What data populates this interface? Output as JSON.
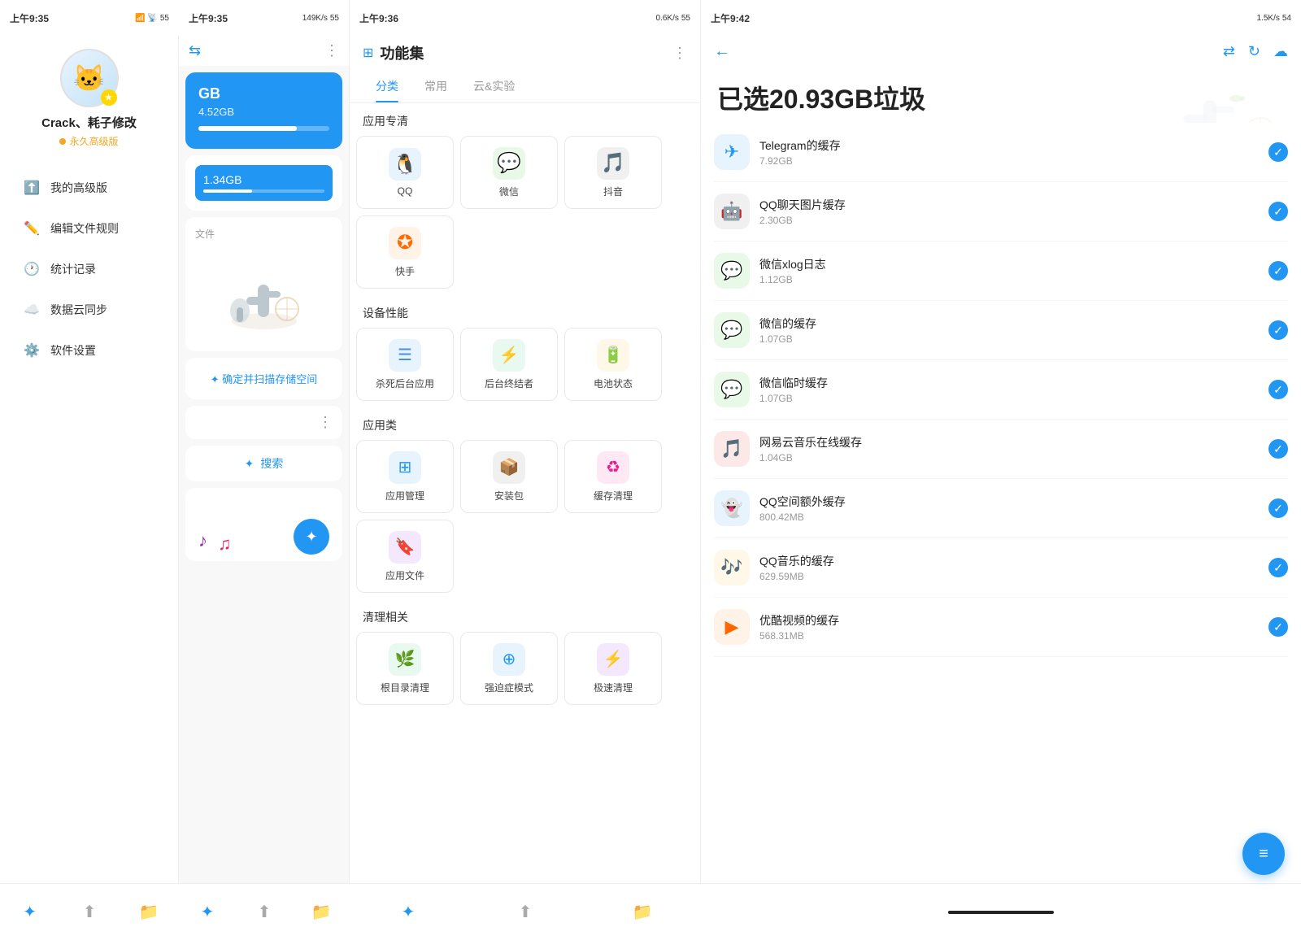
{
  "panel1": {
    "status_time": "上午9:35",
    "username": "Crack、耗子修改",
    "vip_label": "永久高级版",
    "menu_items": [
      {
        "id": "premium",
        "label": "我的高级版",
        "icon": "⬆"
      },
      {
        "id": "rules",
        "label": "编辑文件规则",
        "icon": "✏"
      },
      {
        "id": "history",
        "label": "统计记录",
        "icon": "🕐"
      },
      {
        "id": "cloud",
        "label": "数据云同步",
        "icon": "☁"
      },
      {
        "id": "settings",
        "label": "软件设置",
        "icon": "⚙"
      }
    ],
    "bottom_nav": [
      {
        "id": "clean",
        "icon": "✦",
        "active": true
      },
      {
        "id": "upload",
        "icon": "⬆"
      },
      {
        "id": "folder",
        "icon": "📁"
      }
    ]
  },
  "panel2": {
    "status_time": "上午9:35",
    "status_speed": "149K/s",
    "storage_title": "GB",
    "storage_subtitle": "4.52GB",
    "storage_bar_pct": 75,
    "second_subtitle": "1.34GB",
    "file_label": "文件",
    "confirm_text": "✦ 确定并扫描存储空间",
    "search_icon": "✦",
    "search_label": "搜索",
    "music_note1": "♪",
    "music_note2": "♫",
    "bottom_nav": [
      {
        "id": "clean",
        "icon": "✦",
        "active": true
      },
      {
        "id": "upload",
        "icon": "⬆"
      },
      {
        "id": "folder",
        "icon": "📁"
      }
    ]
  },
  "panel3": {
    "status_time": "上午9:36",
    "status_speed": "0.6K/s",
    "title": "功能集",
    "tabs": [
      {
        "id": "category",
        "label": "分类",
        "active": true
      },
      {
        "id": "common",
        "label": "常用",
        "active": false
      },
      {
        "id": "cloud",
        "label": "云&实验",
        "active": false
      }
    ],
    "sections": [
      {
        "title": "应用专清",
        "items": [
          {
            "id": "qq",
            "label": "QQ",
            "bg": "#1296DB",
            "icon": "🐧"
          },
          {
            "id": "wechat",
            "label": "微信",
            "bg": "#2DC100",
            "icon": "💬"
          },
          {
            "id": "douyin",
            "label": "抖音",
            "bg": "#000",
            "icon": "🎵"
          },
          {
            "id": "kuaishou",
            "label": "快手",
            "bg": "#FF6B00",
            "icon": "✪"
          }
        ]
      },
      {
        "title": "设备性能",
        "items": [
          {
            "id": "kill",
            "label": "杀死后台应用",
            "bg": "#4A90D9",
            "icon": "☰"
          },
          {
            "id": "backend",
            "label": "后台终结者",
            "bg": "#27AE60",
            "icon": "⚡"
          },
          {
            "id": "battery",
            "label": "电池状态",
            "bg": "#F5A623",
            "icon": "🔋"
          }
        ]
      },
      {
        "title": "应用类",
        "items": [
          {
            "id": "appmgr",
            "label": "应用管理",
            "bg": "#2196F3",
            "icon": "⊞"
          },
          {
            "id": "apk",
            "label": "安装包",
            "bg": "#444",
            "icon": "📦"
          },
          {
            "id": "cache",
            "label": "缓存清理",
            "bg": "#E91E8C",
            "icon": "♻"
          },
          {
            "id": "appfile",
            "label": "应用文件",
            "bg": "#9B59B6",
            "icon": "🔖"
          }
        ]
      },
      {
        "title": "清理相关",
        "items": [
          {
            "id": "dir",
            "label": "根目录清理",
            "bg": "#27AE60",
            "icon": "🌿"
          },
          {
            "id": "ocd",
            "label": "强迫症模式",
            "bg": "#2196F3",
            "icon": "⊕"
          },
          {
            "id": "fast",
            "label": "极速清理",
            "bg": "#9B59B6",
            "icon": "⚡"
          }
        ]
      }
    ],
    "bottom_nav": [
      {
        "id": "clean",
        "icon": "✦",
        "active": true
      },
      {
        "id": "upload",
        "icon": "⬆"
      },
      {
        "id": "folder",
        "icon": "📁"
      }
    ]
  },
  "panel4": {
    "status_time": "上午9:42",
    "status_speed": "1.5K/s",
    "junk_total": "已选20.93GB垃圾",
    "items": [
      {
        "id": "telegram",
        "label": "Telegram的缓存",
        "size": "7.92GB",
        "color": "#2196F3",
        "icon": "✈"
      },
      {
        "id": "qq_img",
        "label": "QQ聊天图片缓存",
        "size": "2.30GB",
        "color": "#555",
        "icon": "🤖"
      },
      {
        "id": "wechat_xlog",
        "label": "微信xlog日志",
        "size": "1.12GB",
        "color": "#2DC100",
        "icon": "💬"
      },
      {
        "id": "wechat_cache",
        "label": "微信的缓存",
        "size": "1.07GB",
        "color": "#2DC100",
        "icon": "💬"
      },
      {
        "id": "wechat_tmp",
        "label": "微信临时缓存",
        "size": "1.07GB",
        "color": "#2DC100",
        "icon": "💬"
      },
      {
        "id": "netease",
        "label": "网易云音乐在线缓存",
        "size": "1.04GB",
        "color": "#E53935",
        "icon": "🎵"
      },
      {
        "id": "qq_space",
        "label": "QQ空间额外缓存",
        "size": "800.42MB",
        "color": "#1296DB",
        "icon": "👻"
      },
      {
        "id": "qq_music",
        "label": "QQ音乐的缓存",
        "size": "629.59MB",
        "color": "#F5A623",
        "icon": "🎶"
      },
      {
        "id": "youku",
        "label": "优酷视频的缓存",
        "size": "568.31MB",
        "color": "#FF6600",
        "icon": "▶"
      }
    ],
    "fab_icon": "≡",
    "bottom_nav_indicator": ""
  }
}
